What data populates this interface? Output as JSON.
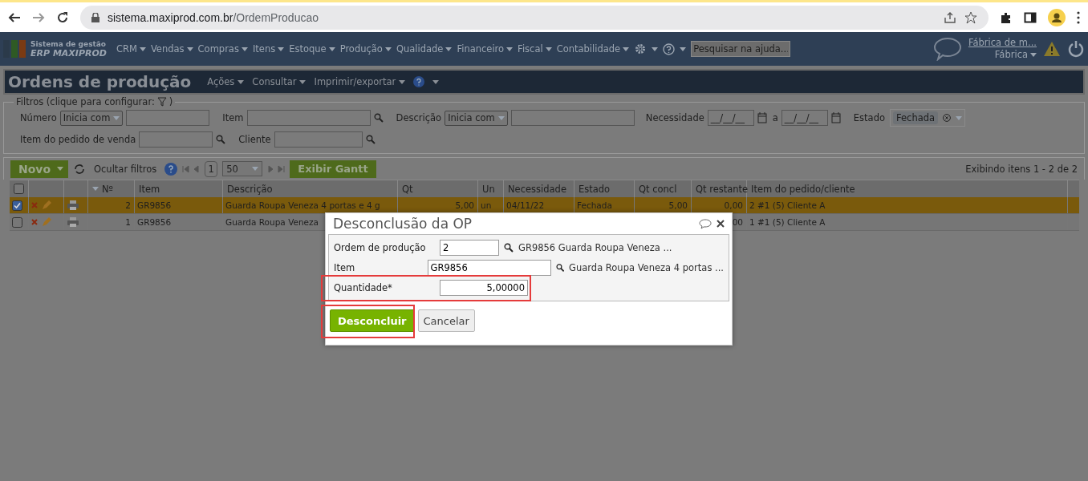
{
  "browser": {
    "url_host": "sistema.maxiprod.com.br",
    "url_path": "/OrdemProducao"
  },
  "nav": {
    "logo_line1": "Sistema de gestão",
    "logo_line2": "ERP MAXIPROD",
    "menus": [
      "CRM",
      "Vendas",
      "Compras",
      "Itens",
      "Estoque",
      "Produção",
      "Qualidade",
      "Financeiro",
      "Fiscal",
      "Contabilidade"
    ],
    "search_placeholder": "Pesquisar na ajuda...",
    "company": "Fábrica de m...",
    "unit": "Fábrica"
  },
  "page": {
    "title": "Ordens de produção",
    "actions": [
      "Ações",
      "Consultar",
      "Imprimir/exportar"
    ]
  },
  "filters": {
    "legend": "Filtros (clique para configurar:",
    "legend_end": ")",
    "numero_label": "Número",
    "numero_mode": "Inicia com",
    "item_label": "Item",
    "descricao_label": "Descrição",
    "descricao_mode": "Inicia com",
    "necessidade_label": "Necessidade",
    "date_from": "__/__/__",
    "date_sep": "a",
    "date_to": "__/__/__",
    "estado_label": "Estado",
    "estado_chip": "Fechada",
    "pedido_label": "Item do pedido de venda",
    "cliente_label": "Cliente"
  },
  "toolbar": {
    "new": "Novo",
    "hide_filters": "Ocultar filtros",
    "page": "1",
    "page_size": "50",
    "gantt": "Exibir Gantt",
    "info": "Exibindo itens 1 - 2 de 2"
  },
  "table": {
    "all_checked": false,
    "columns": [
      "Nº",
      "Item",
      "Descrição",
      "Qt",
      "Un",
      "Necessidade",
      "Estado",
      "Qt concl",
      "Qt restante",
      "Item do pedido/cliente"
    ],
    "rows": [
      {
        "selected": true,
        "cells": [
          "2",
          "GR9856",
          "Guarda Roupa Veneza 4 portas e 4 g",
          "5,00",
          "un",
          "04/11/22",
          "Fechada",
          "5,00",
          "0,00",
          "2 #1 (5) Cliente A"
        ]
      },
      {
        "selected": false,
        "cells": [
          "1",
          "GR9856",
          "Guarda Roupa Veneza",
          null,
          null,
          null,
          null,
          null,
          "00",
          "1 #1 (5) Cliente A"
        ]
      }
    ]
  },
  "dialog": {
    "title": "Desconclusão da OP",
    "ordem_label": "Ordem de produção",
    "ordem_value": "2",
    "ordem_desc": "GR9856 Guarda Roupa Veneza ...",
    "item_label": "Item",
    "item_value": "GR9856",
    "item_desc": "Guarda Roupa Veneza 4 portas ...",
    "qtd_label": "Quantidade*",
    "qtd_value": "5,00000",
    "confirm": "Desconcluir",
    "cancel": "Cancelar"
  }
}
